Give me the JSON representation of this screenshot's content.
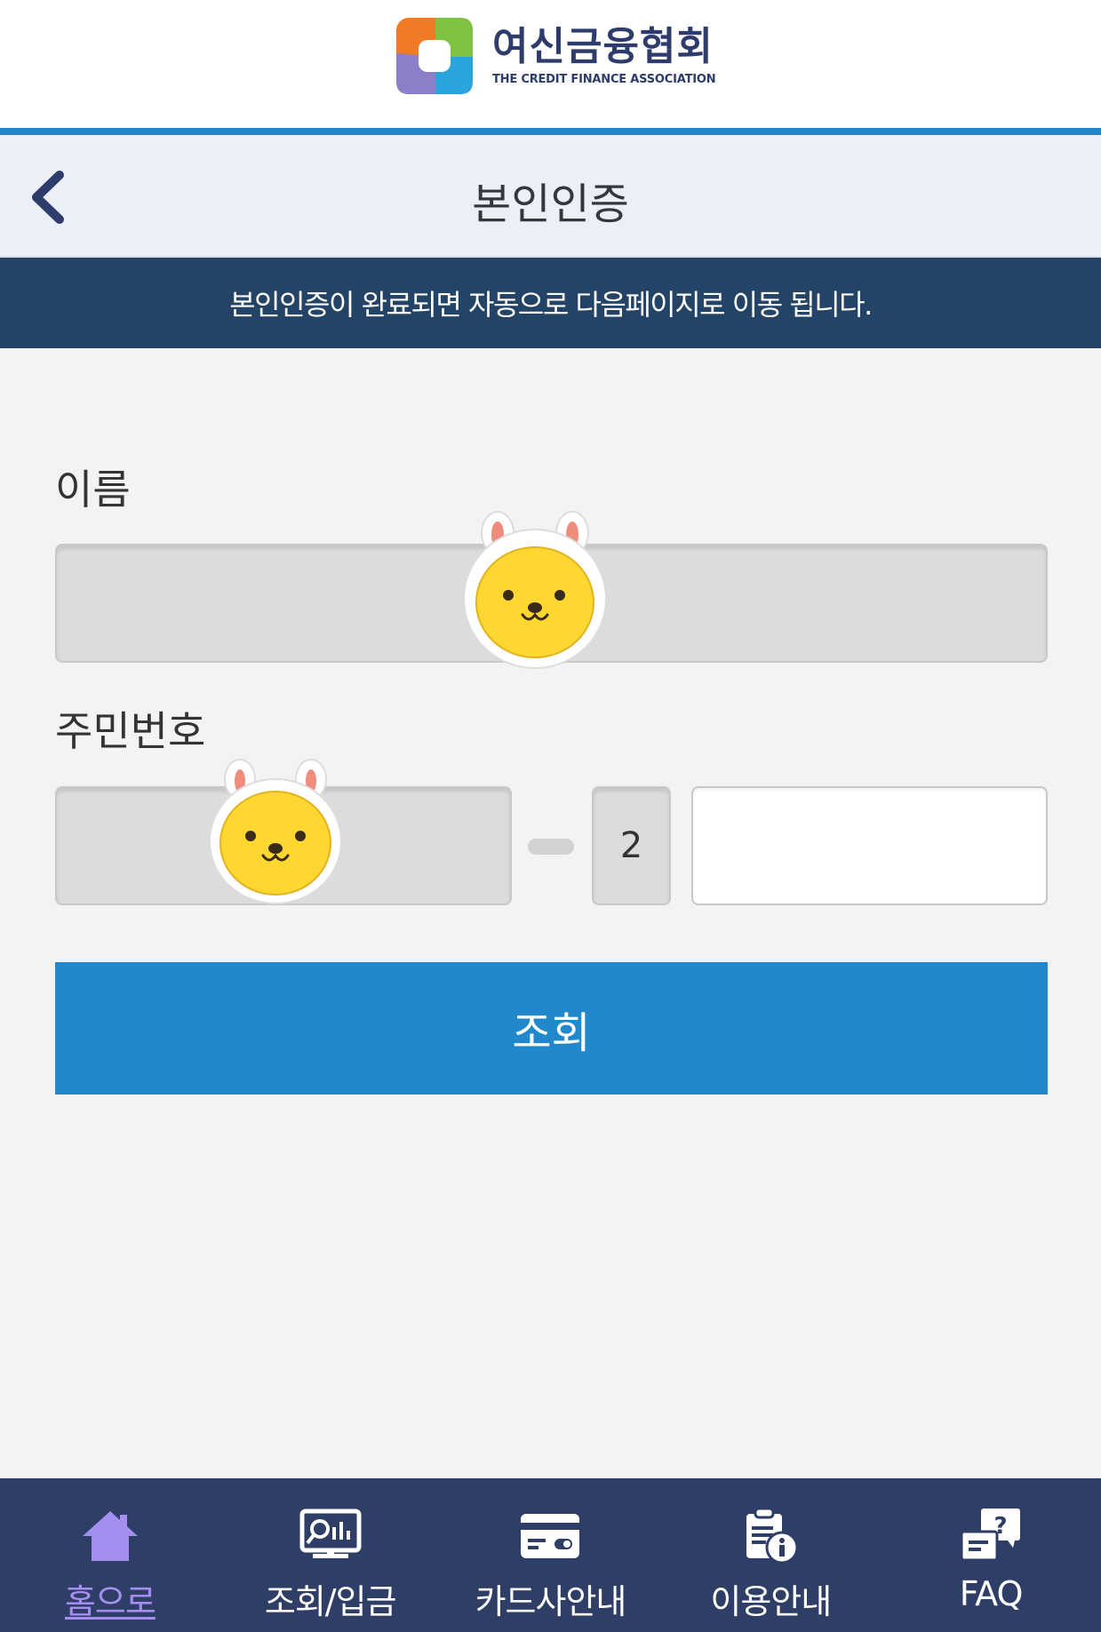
{
  "header": {
    "logo_ko": "여신금융협회",
    "logo_en": "THE CREDIT FINANCE ASSOCIATION",
    "title": "본인인증",
    "back_icon": "chevron-left-icon",
    "notice": "본인인증이 완료되면 자동으로 다음페이지로 이동 됩니다."
  },
  "form": {
    "name_label": "이름",
    "name_value": "",
    "rrn_label": "주민번호",
    "rrn_front_value": "",
    "rrn_gender_digit": "2",
    "rrn_back_value": "",
    "submit_label": "조회"
  },
  "bottom_nav": {
    "items": [
      {
        "label": "홈으로",
        "icon": "home-icon",
        "active": true
      },
      {
        "label": "조회/입금",
        "icon": "search-chart-icon",
        "active": false
      },
      {
        "label": "카드사안내",
        "icon": "credit-card-icon",
        "active": false
      },
      {
        "label": "이용안내",
        "icon": "clipboard-info-icon",
        "active": false
      },
      {
        "label": "FAQ",
        "icon": "faq-icon",
        "active": false
      }
    ]
  },
  "colors": {
    "accent_blue": "#2288cc",
    "notice_bg": "#234466",
    "nav_bg": "#2e3e66",
    "nav_active": "#a48ef0",
    "title_bar_bg": "#ebeff8"
  }
}
